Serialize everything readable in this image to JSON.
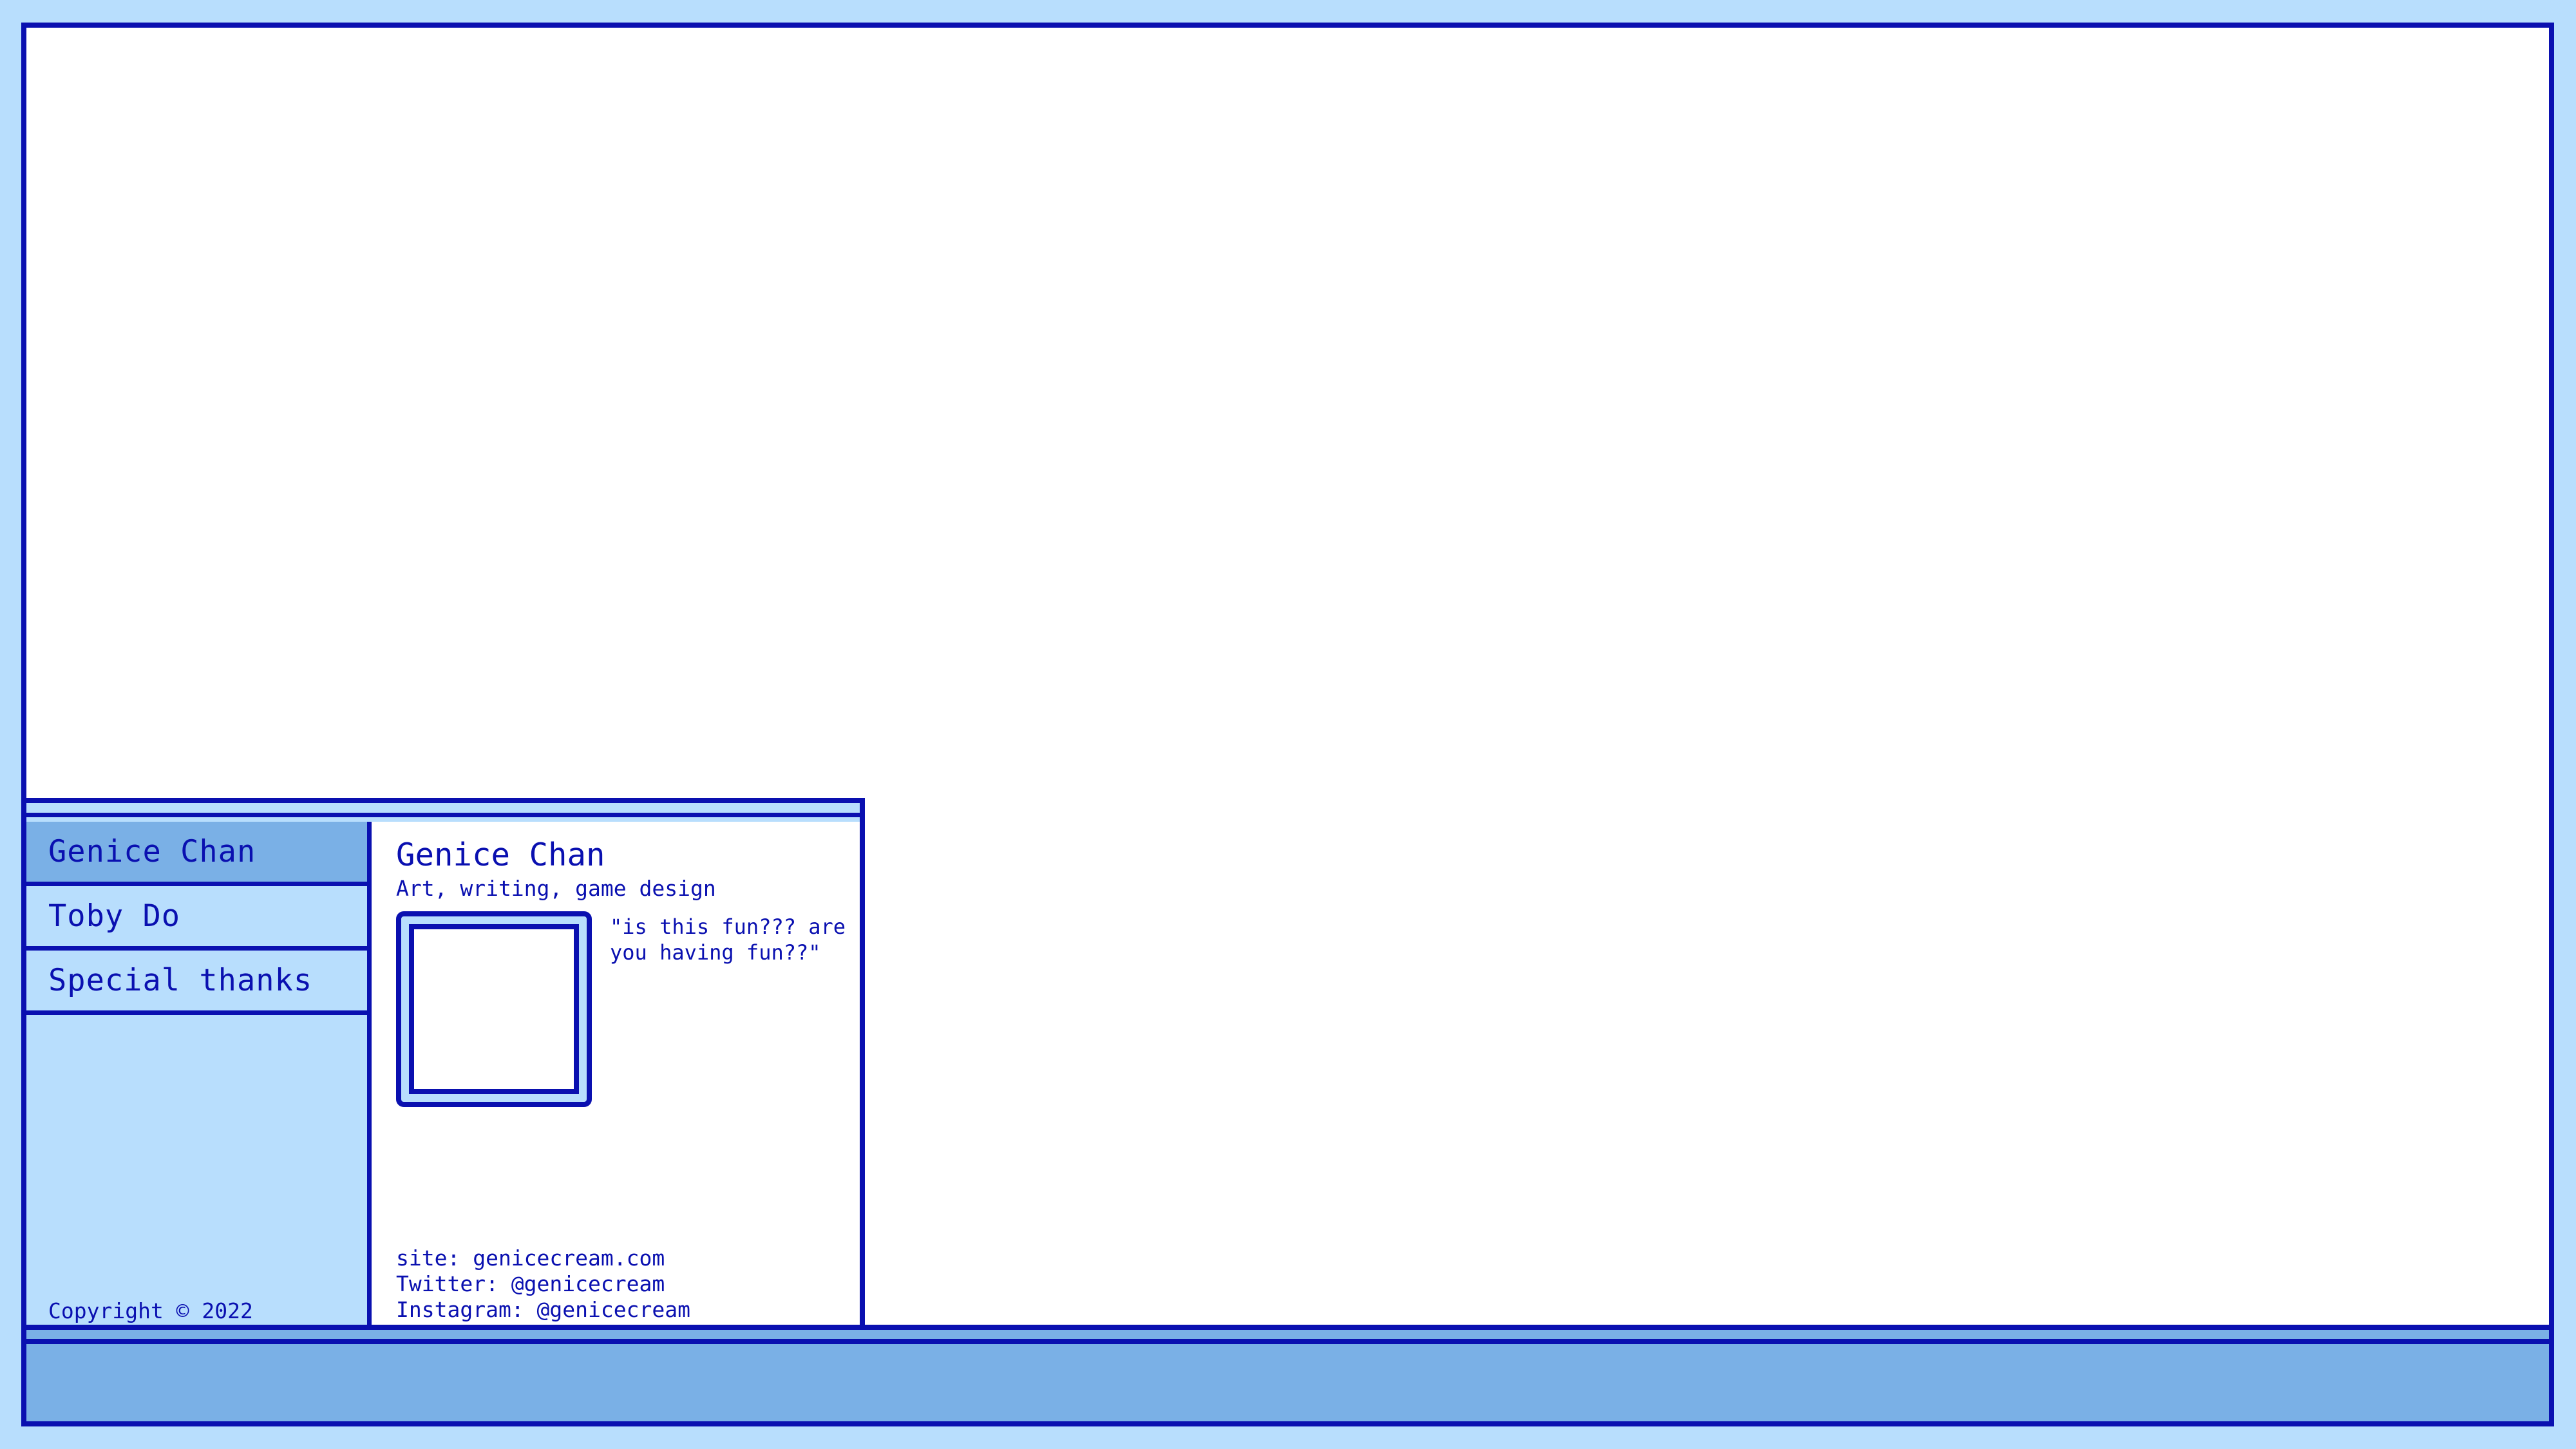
{
  "colors": {
    "background": "#b8defd",
    "border": "#0a10b0",
    "accent": "#7ab0e6",
    "panel": "#ffffff"
  },
  "sidebar": {
    "items": [
      {
        "label": "Genice Chan",
        "active": true
      },
      {
        "label": "Toby Do",
        "active": false
      },
      {
        "label": "Special thanks",
        "active": false
      }
    ],
    "copyright": "Copyright © 2022"
  },
  "profile": {
    "name": "Genice Chan",
    "subtitle": "Art, writing, game design",
    "quote": "\"is this fun??? are you having fun??\"",
    "links": {
      "site": "site: genicecream.com",
      "twitter": "Twitter: @genicecream",
      "instagram": "Instagram: @genicecream"
    }
  }
}
